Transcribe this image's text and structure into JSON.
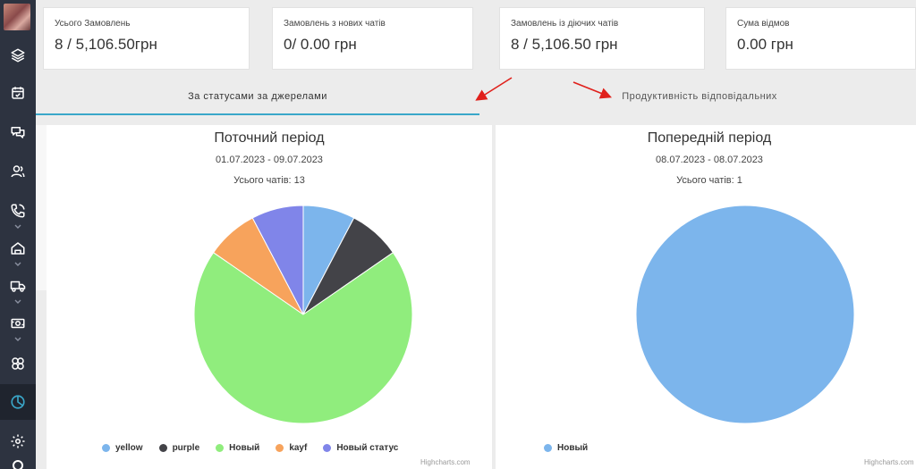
{
  "sidebar": {
    "items": [
      {
        "icon": "layers-icon"
      },
      {
        "icon": "calendar-icon"
      },
      {
        "icon": "chat-icon"
      },
      {
        "icon": "users-icon"
      },
      {
        "icon": "phone-icon"
      },
      {
        "icon": "home-icon"
      },
      {
        "icon": "truck-icon"
      },
      {
        "icon": "cash-icon"
      },
      {
        "icon": "integrations-icon"
      },
      {
        "icon": "analytics-icon",
        "active": true
      },
      {
        "icon": "gear-icon"
      }
    ]
  },
  "cards": [
    {
      "label": "Усього Замовлень",
      "value": "8 / 5,106.50грн"
    },
    {
      "label": "Замовлень з нових чатів",
      "value": "0/ 0.00 грн"
    },
    {
      "label": "Замовлень із діючих чатів",
      "value": "8 / 5,106.50 грн"
    },
    {
      "label": "Сума відмов",
      "value": "0.00 грн"
    }
  ],
  "tabs": [
    {
      "label": "За статусами за джерелами",
      "active": true
    },
    {
      "label": "Продуктивність відповідальних",
      "active": false
    }
  ],
  "colors": {
    "accent": "#3aa7c9",
    "arrow": "#e0201b"
  },
  "chart_data": [
    {
      "type": "pie",
      "title": "Поточний період",
      "date_range": "01.07.2023 - 09.07.2023",
      "total_label": "Усього чатів: 13",
      "credits": "Highcharts.com",
      "legend_position": "bottom",
      "slices": [
        {
          "name": "yellow",
          "value": 1,
          "color": "#7cb5ec"
        },
        {
          "name": "purple",
          "value": 1,
          "color": "#434348"
        },
        {
          "name": "Новый",
          "value": 9,
          "color": "#90ed7d"
        },
        {
          "name": "kayf",
          "value": 1,
          "color": "#f7a35c"
        },
        {
          "name": "Новый статус",
          "value": 1,
          "color": "#8085e9"
        }
      ]
    },
    {
      "type": "pie",
      "title": "Попередній період",
      "date_range": "08.07.2023 - 08.07.2023",
      "total_label": "Усього чатів: 1",
      "credits": "Highcharts.com",
      "legend_position": "bottom",
      "slices": [
        {
          "name": "Новый",
          "value": 1,
          "color": "#7cb5ec"
        }
      ]
    }
  ]
}
